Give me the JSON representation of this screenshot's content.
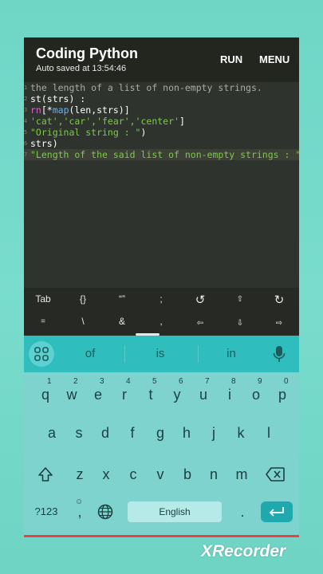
{
  "appbar": {
    "title": "Coding Python",
    "subtitle": "Auto saved at 13:54:46",
    "run_label": "RUN",
    "menu_label": "MENU"
  },
  "editor": {
    "line_numbers": [
      "1",
      "2",
      "3",
      "4",
      "5",
      "6",
      "7"
    ],
    "lines": [
      [
        {
          "t": "the length of a list of non-empty strings.",
          "c": "gray"
        }
      ],
      [
        {
          "t": "st(strs) :",
          "c": "white"
        }
      ],
      [
        {
          "t": "rn",
          "c": "pink"
        },
        {
          "t": "[*",
          "c": "white"
        },
        {
          "t": "map",
          "c": "blue"
        },
        {
          "t": "(len,strs)]",
          "c": "white"
        }
      ],
      [
        {
          "t": "'cat','car','fear','center'",
          "c": "green"
        },
        {
          "t": "]",
          "c": "white"
        }
      ],
      [
        {
          "t": "\"Original string : \"",
          "c": "green"
        },
        {
          "t": ")",
          "c": "white"
        }
      ],
      [
        {
          "t": "strs)",
          "c": "white"
        }
      ],
      [
        {
          "t": "\"Length of the said list of non-empty strings : \"",
          "c": "green"
        },
        {
          "t": ")",
          "c": "white"
        }
      ]
    ]
  },
  "extra_keys": {
    "row1": [
      "Tab",
      "{}",
      "“”",
      ";",
      "↺",
      "⇧",
      "↻"
    ],
    "row2": [
      "=",
      "\\",
      "&",
      ",",
      "⇦",
      "⇩",
      "⇨"
    ]
  },
  "keyboard": {
    "suggestions": [
      "of",
      "is",
      "in"
    ],
    "row1": [
      {
        "k": "q",
        "s": "1"
      },
      {
        "k": "w",
        "s": "2"
      },
      {
        "k": "e",
        "s": "3"
      },
      {
        "k": "r",
        "s": "4"
      },
      {
        "k": "t",
        "s": "5"
      },
      {
        "k": "y",
        "s": "6"
      },
      {
        "k": "u",
        "s": "7"
      },
      {
        "k": "i",
        "s": "8"
      },
      {
        "k": "o",
        "s": "9"
      },
      {
        "k": "p",
        "s": "0"
      }
    ],
    "row2": [
      "a",
      "s",
      "d",
      "f",
      "g",
      "h",
      "j",
      "k",
      "l"
    ],
    "row3": [
      "z",
      "x",
      "c",
      "v",
      "b",
      "n",
      "m"
    ],
    "symbols_label": "?123",
    "comma": ",",
    "space_label": "English",
    "period": "."
  },
  "watermark": "XRecorder",
  "colors": {
    "background": "#79dccd",
    "editor_bg": "#2f332d",
    "appbar_bg": "#23251f",
    "suggestion_bar": "#2fbdbd",
    "keyboard_bg": "#7ed3cf",
    "enter_key": "#1fa9ae",
    "accent_line": "#e8433f"
  }
}
